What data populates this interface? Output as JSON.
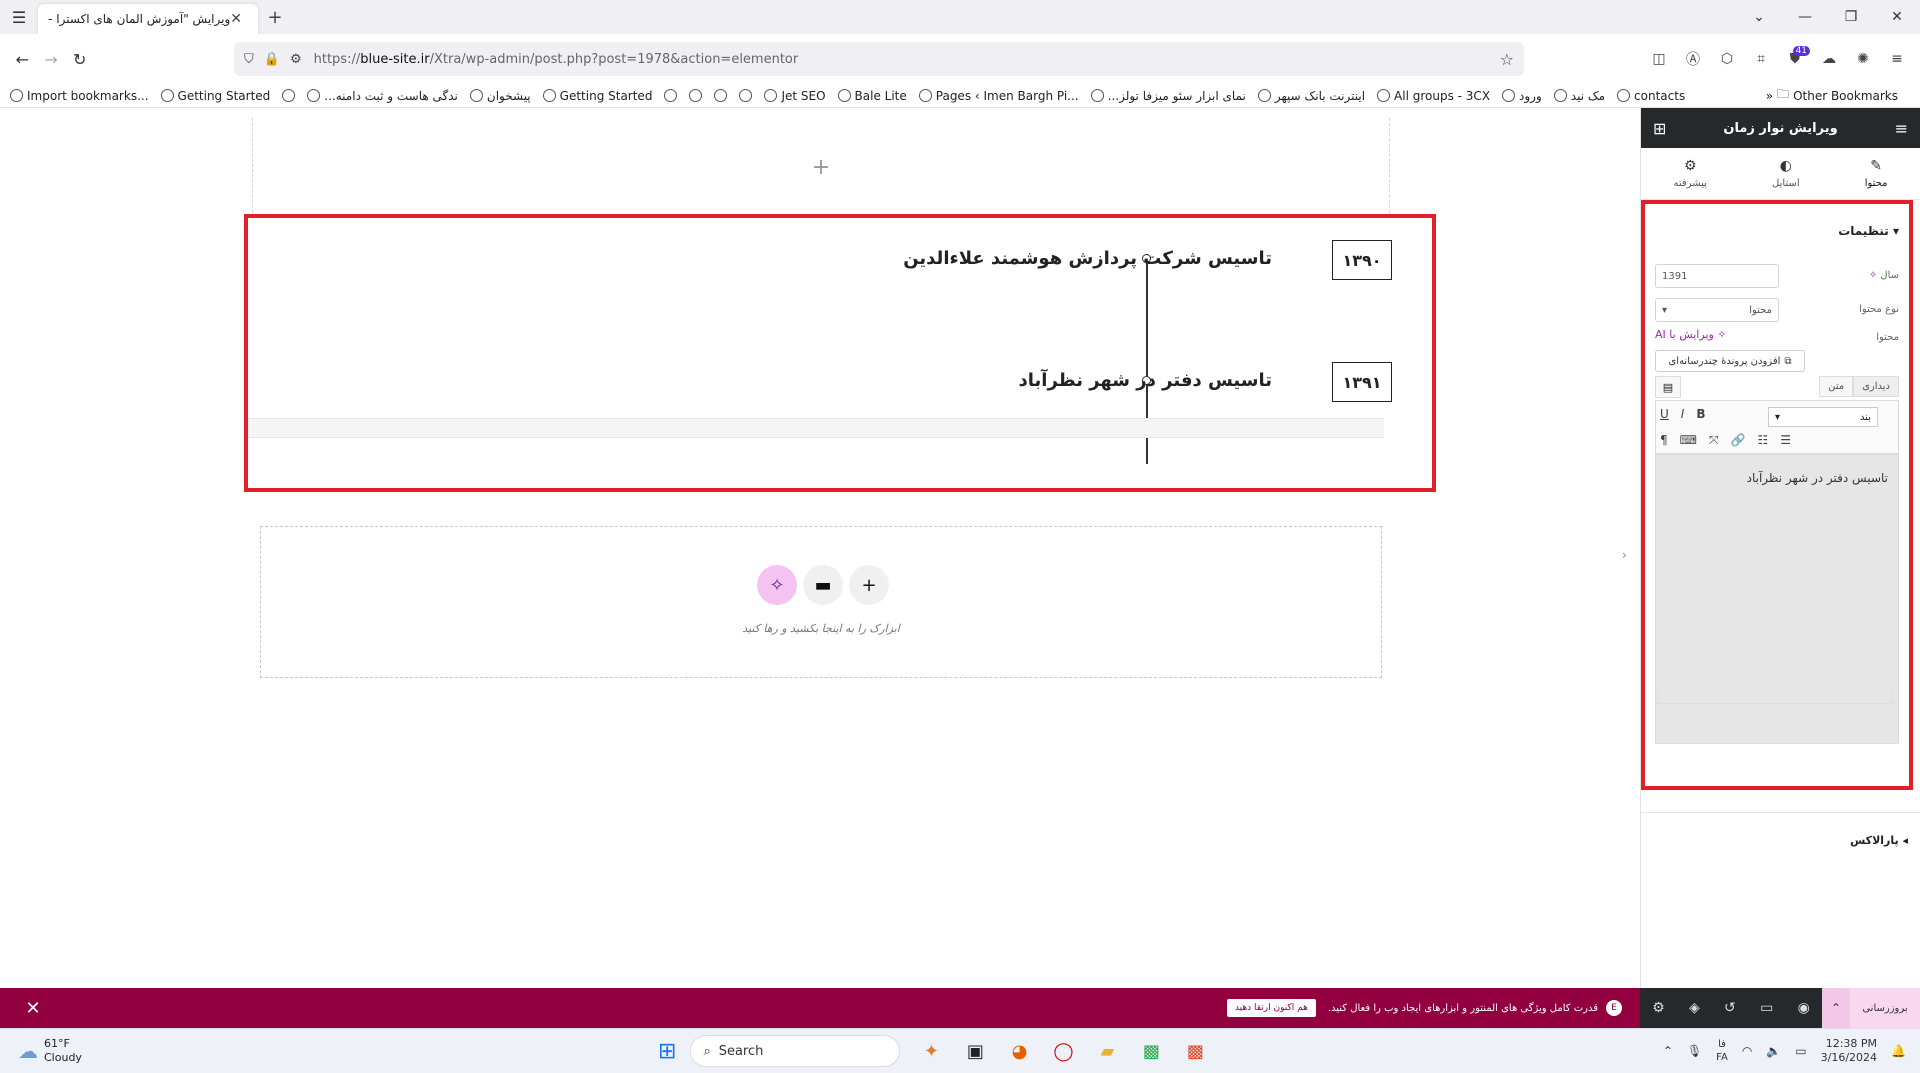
{
  "browser": {
    "tab_title": "ویرایش \"آموزش المان های اکسترا - ع",
    "url_prefix": "https://",
    "url_domain": "blue-site.ir",
    "url_path": "/Xtra/wp-admin/post.php?post=1978&action=elementor",
    "ext_badge": "41"
  },
  "bookmarks": [
    {
      "label": "Import bookmarks..."
    },
    {
      "label": "Getting Started"
    },
    {
      "label": ""
    },
    {
      "label": "...ندگی هاست و ثبت دامنه"
    },
    {
      "label": "پیشخوان"
    },
    {
      "label": "Getting Started"
    },
    {
      "label": ""
    },
    {
      "label": ""
    },
    {
      "label": ""
    },
    {
      "label": ""
    },
    {
      "label": "Jet SEO"
    },
    {
      "label": "Bale Lite"
    },
    {
      "label": "Pages ‹ Imen Bargh Pi..."
    },
    {
      "label": "...نمای ابزار سئو میزفا تولز"
    },
    {
      "label": "اینترنت بانک سپهر"
    },
    {
      "label": "All groups - 3CX"
    },
    {
      "label": "ورود"
    },
    {
      "label": "مک نید"
    },
    {
      "label": "contacts"
    }
  ],
  "other_bookmarks": "Other Bookmarks",
  "timeline": {
    "items": [
      {
        "year": "۱۳۹۰",
        "title": "تاسیس شرکت پردازش هوشمند علاءالدین"
      },
      {
        "year": "۱۳۹۱",
        "title": "تاسیس دفتر در شهر نظرآباد"
      }
    ]
  },
  "dropzone": {
    "hint": "ابزارک را به اینجا بکشید و رها کنید"
  },
  "panel": {
    "title": "ویرایش نوار زمان",
    "tabs": [
      {
        "label": "محتوا",
        "icon": "pencil-icon"
      },
      {
        "label": "استایل",
        "icon": "contrast-icon"
      },
      {
        "label": "پیشرفته",
        "icon": "gear-icon"
      }
    ],
    "section_title": "تنظیمات",
    "year_label": "سال",
    "year_value": "1391",
    "content_type_label": "نوع محتوا",
    "content_type_value": "محتوا",
    "content_label": "محتوا",
    "ai_link": "ویرایش با AI",
    "media_button": "افزودن پروندهٔ چندرسانه‌ای",
    "editor_tab_visual": "دیداری",
    "editor_tab_text": "متن",
    "paragraph_select": "بند",
    "editor_content": "تاسیس دفتر در شهر نظرآباد",
    "parallax_title": "پارالاکس"
  },
  "promo": {
    "text": "قدرت کامل ویژگی های المنتور و ابزارهای ایجاد وب را فعال کنید.",
    "button": "هم اکنون ارتقا دهید",
    "update_label": "بروزرسانی"
  },
  "taskbar": {
    "temp": "61°F",
    "weather": "Cloudy",
    "search": "Search",
    "lang_top": "فا",
    "lang_bottom": "FA",
    "time": "12:38 PM",
    "date": "3/16/2024"
  }
}
